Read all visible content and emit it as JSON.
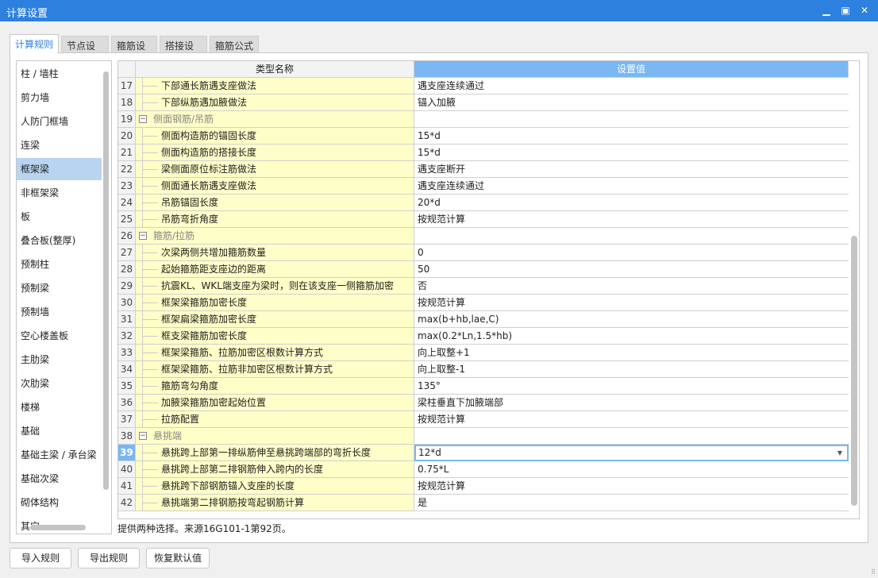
{
  "window": {
    "title": "计算设置"
  },
  "tabs": [
    {
      "label": "计算规则",
      "active": true
    },
    {
      "label": "节点设置"
    },
    {
      "label": "箍筋设置"
    },
    {
      "label": "搭接设置"
    },
    {
      "label": "箍筋公式"
    }
  ],
  "sidebar": {
    "selected": "框架梁",
    "items": [
      "柱 / 墙柱",
      "剪力墙",
      "人防门框墙",
      "连梁",
      "框架梁",
      "非框架梁",
      "板",
      "叠合板(整厚)",
      "预制柱",
      "预制梁",
      "预制墙",
      "空心楼盖板",
      "主肋梁",
      "次肋梁",
      "楼梯",
      "基础",
      "基础主梁 / 承台梁",
      "基础次梁",
      "砌体结构",
      "其它"
    ]
  },
  "grid": {
    "headers": {
      "name": "类型名称",
      "value": "设置值"
    },
    "current_row": "39",
    "rows": [
      {
        "n": "17",
        "name": "下部通长筋遇支座做法",
        "value": "遇支座连续通过"
      },
      {
        "n": "18",
        "name": "下部纵筋遇加腋做法",
        "value": "锚入加腋"
      },
      {
        "n": "19",
        "name": "侧面钢筋/吊筋",
        "value": "",
        "group": true
      },
      {
        "n": "20",
        "name": "侧面构造筋的锚固长度",
        "value": "15*d"
      },
      {
        "n": "21",
        "name": "侧面构造筋的搭接长度",
        "value": "15*d"
      },
      {
        "n": "22",
        "name": "梁侧面原位标注筋做法",
        "value": "遇支座断开"
      },
      {
        "n": "23",
        "name": "侧面通长筋遇支座做法",
        "value": "遇支座连续通过"
      },
      {
        "n": "24",
        "name": "吊筋锚固长度",
        "value": "20*d"
      },
      {
        "n": "25",
        "name": "吊筋弯折角度",
        "value": "按规范计算"
      },
      {
        "n": "26",
        "name": "箍筋/拉筋",
        "value": "",
        "group": true
      },
      {
        "n": "27",
        "name": "次梁两侧共增加箍筋数量",
        "value": "0"
      },
      {
        "n": "28",
        "name": "起始箍筋距支座边的距离",
        "value": "50"
      },
      {
        "n": "29",
        "name": "抗震KL、WKL端支座为梁时，则在该支座一侧箍筋加密",
        "value": "否"
      },
      {
        "n": "30",
        "name": "框架梁箍筋加密长度",
        "value": "按规范计算"
      },
      {
        "n": "31",
        "name": "框架扁梁箍筋加密长度",
        "value": "max(b+hb,lae,C)"
      },
      {
        "n": "32",
        "name": "框支梁箍筋加密长度",
        "value": "max(0.2*Ln,1.5*hb)"
      },
      {
        "n": "33",
        "name": "框架梁箍筋、拉筋加密区根数计算方式",
        "value": "向上取整+1"
      },
      {
        "n": "34",
        "name": "框架梁箍筋、拉筋非加密区根数计算方式",
        "value": "向上取整-1"
      },
      {
        "n": "35",
        "name": "箍筋弯勾角度",
        "value": "135°"
      },
      {
        "n": "36",
        "name": "加腋梁箍筋加密起始位置",
        "value": "梁柱垂直下加腋端部"
      },
      {
        "n": "37",
        "name": "拉筋配置",
        "value": "按规范计算"
      },
      {
        "n": "38",
        "name": "悬挑端",
        "value": "",
        "group": true
      },
      {
        "n": "39",
        "name": "悬挑跨上部第一排纵筋伸至悬挑跨端部的弯折长度",
        "value": "12*d",
        "editing": true
      },
      {
        "n": "40",
        "name": "悬挑跨上部第二排钢筋伸入跨内的长度",
        "value": "0.75*L"
      },
      {
        "n": "41",
        "name": "悬挑跨下部钢筋锚入支座的长度",
        "value": "按规范计算"
      },
      {
        "n": "42",
        "name": "悬挑端第二排钢筋按弯起钢筋计算",
        "value": "是"
      }
    ]
  },
  "status": "提供两种选择。来源16G101-1第92页。",
  "buttons": {
    "import": "导入规则",
    "export": "导出规则",
    "restore": "恢复默认值"
  }
}
